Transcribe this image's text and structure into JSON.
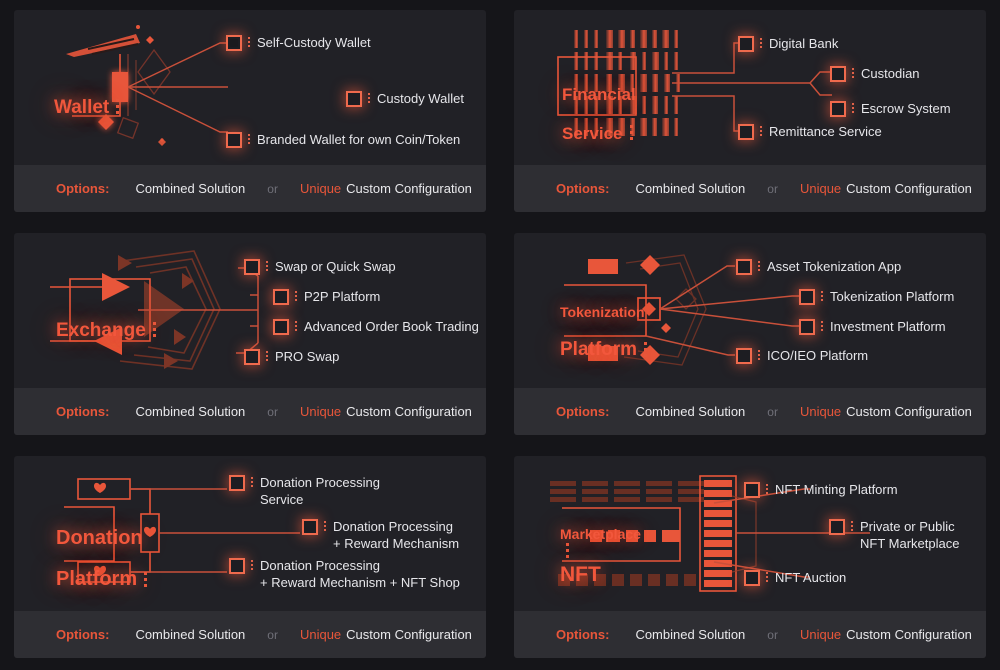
{
  "page": {
    "background": "#151519",
    "card_bg": "#212126",
    "footer_bg": "#2e2e33",
    "accent": "#e8563a",
    "text": "#e6e6ea"
  },
  "footer": {
    "options_label": "Options:",
    "combined": "Combined Solution",
    "or": "or",
    "unique": "Unique",
    "custom": "Custom Configuration"
  },
  "cards": [
    {
      "id": "wallet",
      "title": "Wallet",
      "subtitle": "",
      "icon": "wallet-icon",
      "items": [
        {
          "label": "Self-Custody Wallet"
        },
        {
          "label": "Custody Wallet"
        },
        {
          "label": "Branded Wallet for own Coin/Token"
        }
      ]
    },
    {
      "id": "financial-service",
      "title": "Financial",
      "subtitle": "Service",
      "icon": "barcode-icon",
      "items": [
        {
          "label": "Digital Bank"
        },
        {
          "label": "Custodian"
        },
        {
          "label": "Escrow System"
        },
        {
          "label": "Remittance Service"
        }
      ]
    },
    {
      "id": "exchange",
      "title": "Exchange",
      "subtitle": "",
      "icon": "exchange-arrows-icon",
      "items": [
        {
          "label": "Swap or Quick Swap"
        },
        {
          "label": "P2P Platform"
        },
        {
          "label": "Advanced Order Book Trading"
        },
        {
          "label": "PRO Swap"
        }
      ]
    },
    {
      "id": "tokenization-platform",
      "title": "Tokenization",
      "subtitle": "Platform",
      "icon": "diamond-token-icon",
      "items": [
        {
          "label": "Asset Tokenization App"
        },
        {
          "label": "Tokenization Platform"
        },
        {
          "label": "Investment Platform"
        },
        {
          "label": "ICO/IEO Platform"
        }
      ]
    },
    {
      "id": "donation-platform",
      "title": "Donation",
      "subtitle": "Platform",
      "icon": "heart-icon",
      "items": [
        {
          "label": "Donation Processing\nService"
        },
        {
          "label": "Donation Processing\n+ Reward Mechanism"
        },
        {
          "label": "Donation Processing\n+ Reward Mechanism + NFT Shop"
        }
      ]
    },
    {
      "id": "marketplace-nft",
      "title": "Marketplace",
      "subtitle": "NFT",
      "icon": "grid-blocks-icon",
      "items": [
        {
          "label": "NFT Minting Platform"
        },
        {
          "label": "Private or Public\nNFT Marketplace"
        },
        {
          "label": "NFT Auction"
        }
      ]
    }
  ]
}
